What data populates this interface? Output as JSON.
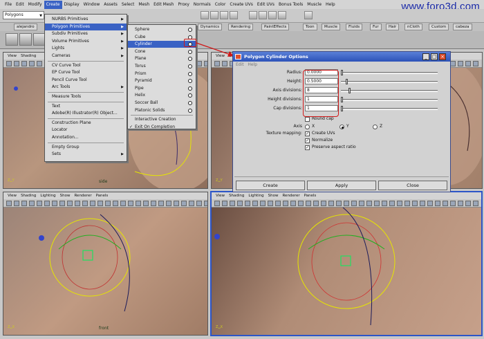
{
  "menubar": [
    "File",
    "Edit",
    "Modify",
    "Create",
    "Display",
    "Window",
    "Assets",
    "Select",
    "Mesh",
    "Edit Mesh",
    "Proxy",
    "Normals",
    "Color",
    "Create UVs",
    "Edit UVs",
    "Bonus Tools",
    "Muscle",
    "Help"
  ],
  "brand": "www.foro3d.com",
  "status": {
    "mode": "Polygons"
  },
  "shelf": {
    "tabs_left": [
      "alejandro"
    ],
    "tabs": [
      "Dynamics",
      "Rendering",
      "PaintEffects",
      "Toon",
      "Muscle",
      "Fluids",
      "Fur",
      "Hair",
      "nCloth",
      "Custom",
      "cabeza"
    ]
  },
  "create_menu": {
    "items": [
      "NURBS Primitives",
      "Polygon Primitives",
      "Subdiv Primitives",
      "Volume Primitives",
      "Lights",
      "Cameras",
      "CV Curve Tool",
      "EP Curve Tool",
      "Pencil Curve Tool",
      "Arc Tools",
      "Measure Tools",
      "Text",
      "Adobe(R) Illustrator(R) Object...",
      "Construction Plane",
      "Locator",
      "Annotation...",
      "Empty Group",
      "Sets"
    ]
  },
  "poly_menu": {
    "items": [
      "Sphere",
      "Cube",
      "Cylinder",
      "Cone",
      "Plane",
      "Torus",
      "Prism",
      "Pyramid",
      "Pipe",
      "Helix",
      "Soccer Ball",
      "Platonic Solids",
      "Interactive Creation",
      "Exit On Completion"
    ]
  },
  "viewport_menu": [
    "View",
    "Shading",
    "Lighting",
    "Show",
    "Renderer",
    "Panels"
  ],
  "viewports": {
    "top_left_label": "side",
    "bottom_left_label": "front"
  },
  "dialog": {
    "title": "Polygon Cylinder Options",
    "menu_edit": "Edit",
    "menu_help": "Help",
    "fields": [
      {
        "label": "Radius:",
        "value": "0.0000",
        "slider": 0.0
      },
      {
        "label": "Height:",
        "value": "0.5000",
        "slider": 0.05
      },
      {
        "label": "Axis divisions:",
        "value": "8",
        "slider": 0.08
      },
      {
        "label": "Height divisions:",
        "value": "1",
        "slider": 0.0
      },
      {
        "label": "Cap divisions:",
        "value": "1",
        "slider": 0.0
      }
    ],
    "round_cap": "Round cap",
    "axis_label": "Axis",
    "axis_x": "X",
    "axis_y": "Y",
    "axis_z": "Z",
    "texture_label": "Texture mapping:",
    "create_uvs": "Create UVs",
    "normalize": "Normalize",
    "preserve": "Preserve aspect ratio",
    "btn_create": "Create",
    "btn_apply": "Apply",
    "btn_close": "Close"
  },
  "colors": {
    "accent": "#3a62c4",
    "highlight_box": "#d01818"
  }
}
